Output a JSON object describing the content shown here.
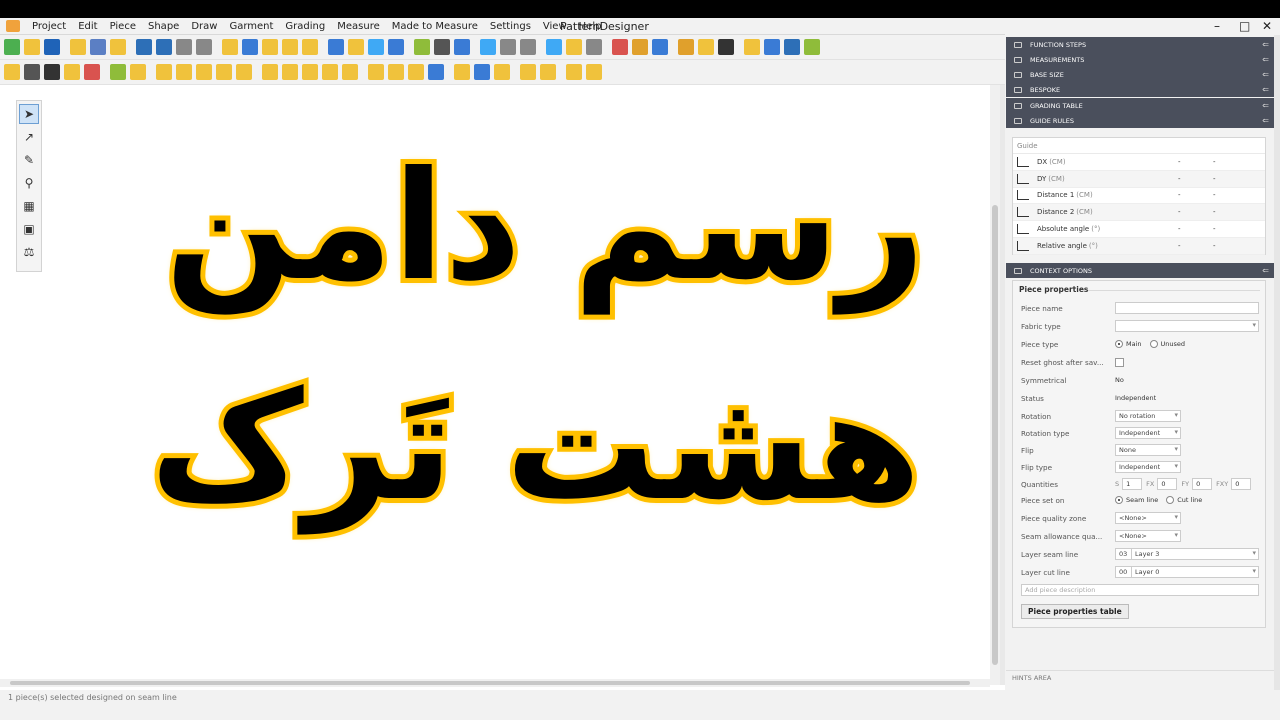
{
  "app": {
    "title": "PatternDesigner",
    "window_controls": [
      "–",
      "□",
      "✕"
    ]
  },
  "menu": [
    "Project",
    "Edit",
    "Piece",
    "Shape",
    "Draw",
    "Garment",
    "Grading",
    "Measure",
    "Made to Measure",
    "Settings",
    "View",
    "Help"
  ],
  "toolbar": {
    "row1_colors": [
      "#4caf50",
      "#f0c23c",
      "#1f63b8",
      "#f0c23c",
      "#5b7fc4",
      "#f0c23c",
      "#2d6fb7",
      "#2d6fb7",
      "#888888",
      "#888888",
      "#f0c23c",
      "#3a7bd5",
      "#f0c23c",
      "#f0c23c",
      "#f0c23c",
      "#3a7bd5",
      "#f0c23c",
      "#3fa9f5",
      "#3a7bd5",
      "#8fbc3a",
      "#555555",
      "#3a7bd5",
      "#3fa9f5",
      "#888888",
      "#888888",
      "#3fa9f5",
      "#f0c23c",
      "#888888",
      "#d9534f",
      "#e0a02c",
      "#3a7bd5",
      "#e0a02c",
      "#f0c23c",
      "#333333",
      "#f0c23c",
      "#3a7bd5",
      "#2d6fb7",
      "#8fbc3a"
    ],
    "row2_colors": [
      "#f0c23c",
      "#555555",
      "#333333",
      "#f0c23c",
      "#d9534f",
      "#8fbc3a",
      "#f0c23c",
      "#f0c23c",
      "#f0c23c",
      "#f0c23c",
      "#f0c23c",
      "#f0c23c",
      "#f0c23c",
      "#f0c23c",
      "#f0c23c",
      "#f0c23c",
      "#f0c23c",
      "#f0c23c",
      "#f0c23c",
      "#f0c23c",
      "#3a7bd5",
      "#f0c23c",
      "#3a7bd5",
      "#f0c23c",
      "#f0c23c",
      "#f0c23c",
      "#f0c23c",
      "#f0c23c"
    ]
  },
  "canvas": {
    "title_line1": "رسم دامن",
    "title_line2": "هشت تَرک",
    "text_stroke_color": "#ffc000"
  },
  "tools": [
    "select-arrow",
    "curve-point",
    "pencil",
    "measure-tool",
    "piece-tool",
    "stamp-tool",
    "scale-tool"
  ],
  "status": "1 piece(s) selected designed on seam line",
  "panels": {
    "accordion": [
      "FUNCTION STEPS",
      "MEASUREMENTS",
      "BASE SIZE",
      "BESPOKE",
      "GRADING TABLE",
      "GUIDE RULES"
    ],
    "guide": {
      "header": "Guide",
      "rows": [
        {
          "label": "DX",
          "unit": "(CM)",
          "v1": "-",
          "v2": "-"
        },
        {
          "label": "DY",
          "unit": "(CM)",
          "v1": "-",
          "v2": "-"
        },
        {
          "label": "Distance 1",
          "unit": "(CM)",
          "v1": "-",
          "v2": "-"
        },
        {
          "label": "Distance 2",
          "unit": "(CM)",
          "v1": "-",
          "v2": "-"
        },
        {
          "label": "Absolute angle",
          "unit": "(°)",
          "v1": "-",
          "v2": "-"
        },
        {
          "label": "Relative angle",
          "unit": "(°)",
          "v1": "-",
          "v2": "-"
        }
      ]
    },
    "context": {
      "header": "CONTEXT OPTIONS",
      "section": "Piece properties",
      "labels": {
        "piece_name": "Piece name",
        "fabric_type": "Fabric type",
        "piece_type": "Piece type",
        "reset_ghost": "Reset ghost after sav...",
        "symmetrical": "Symmetrical",
        "status": "Status",
        "rotation": "Rotation",
        "rotation_type": "Rotation type",
        "flip": "Flip",
        "flip_type": "Flip type",
        "quantities": "Quantities",
        "piece_set_on": "Piece set on",
        "quality_zone": "Piece quality zone",
        "seam_quality": "Seam allowance qua...",
        "layer_seam": "Layer seam line",
        "layer_cut": "Layer cut line"
      },
      "values": {
        "piece_name": "",
        "fabric_type": "",
        "piece_type_main": "Main",
        "piece_type_unused": "Unused",
        "symmetrical": "No",
        "status": "Independent",
        "rotation": "No rotation",
        "rotation_type": "Independent",
        "flip": "None",
        "flip_type": "Independent",
        "q_s_label": "S",
        "q_s": "1",
        "q_fx_label": "FX",
        "q_fx": "0",
        "q_fy_label": "FY",
        "q_fy": "0",
        "q_fxy_label": "FXY",
        "q_fxy": "0",
        "set_on_seam": "Seam line",
        "set_on_cut": "Cut line",
        "quality_zone": "<None>",
        "seam_quality": "<None>",
        "layer_seam_num": "03",
        "layer_seam": "Layer 3",
        "layer_cut_num": "00",
        "layer_cut": "Layer 0",
        "description_placeholder": "Add piece description"
      },
      "button": "Piece properties table"
    },
    "hints": "HINTS AREA"
  }
}
